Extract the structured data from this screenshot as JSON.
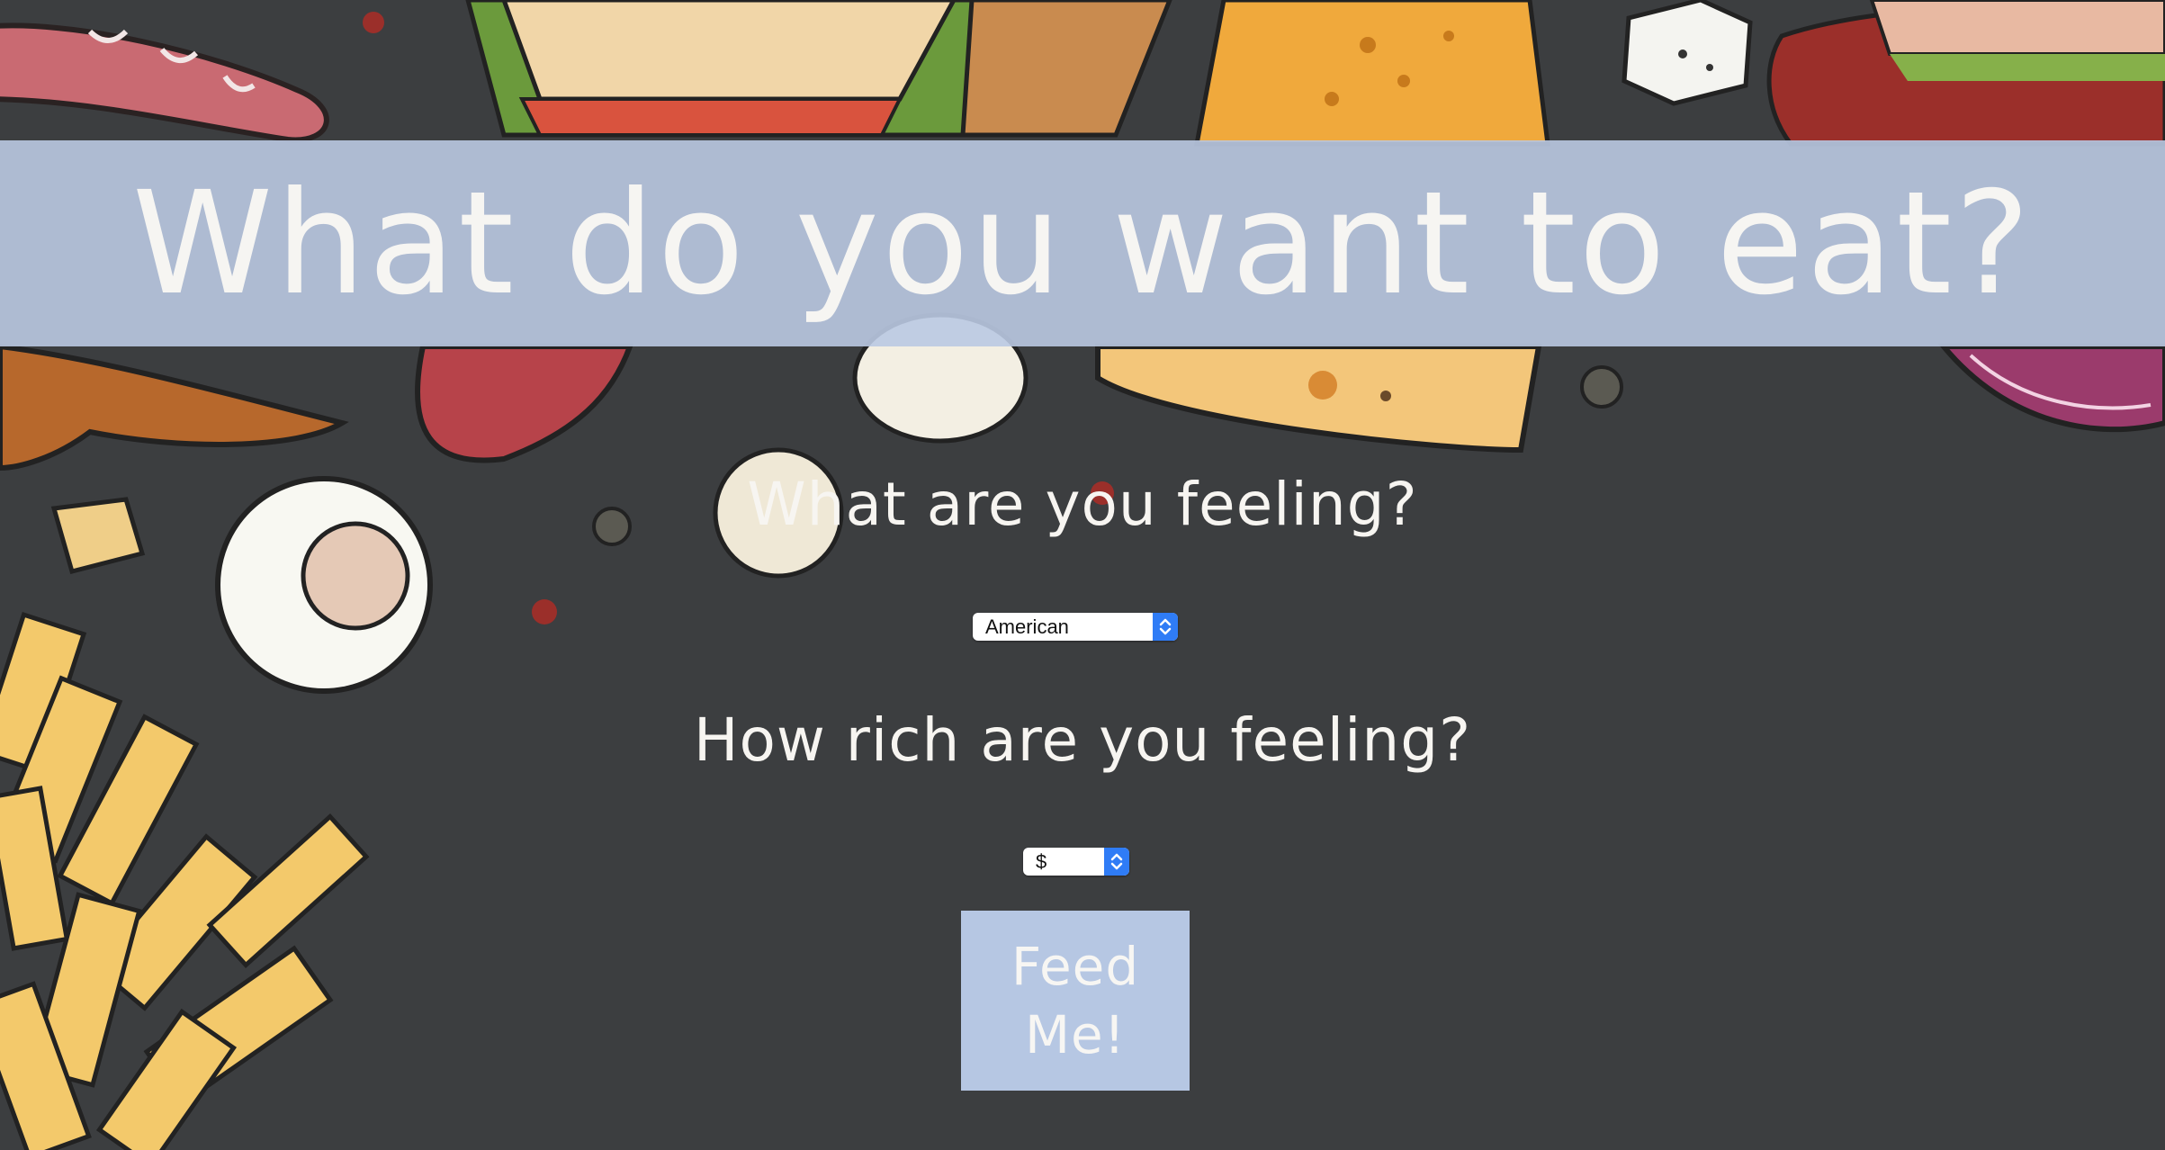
{
  "page": {
    "title": "What do you want to eat?"
  },
  "form": {
    "cuisine_question": "What are you feeling?",
    "cuisine_selected": "American",
    "price_question": "How rich are you feeling?",
    "price_selected": "$",
    "submit_label": "Feed Me!"
  },
  "icons": {
    "select_arrows": "up-down-chevron-icon"
  },
  "colors": {
    "background": "#3c3e40",
    "banner": "#bac9e2",
    "button": "#b6c7e3",
    "select_accent": "#2f7cf6",
    "text": "#f7f5f1"
  }
}
